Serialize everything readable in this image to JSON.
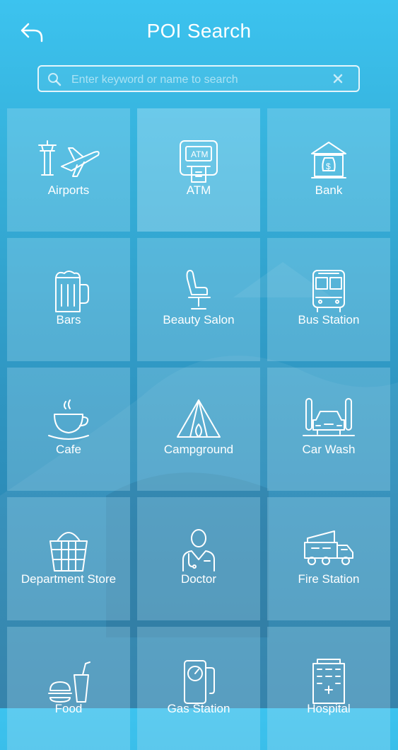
{
  "header": {
    "title": "POI Search"
  },
  "search": {
    "placeholder": "Enter keyword or name to search",
    "value": ""
  },
  "categories": [
    {
      "label": "Airports",
      "icon": "airport-icon"
    },
    {
      "label": "ATM",
      "icon": "atm-icon"
    },
    {
      "label": "Bank",
      "icon": "bank-icon"
    },
    {
      "label": "Bars",
      "icon": "beer-mug-icon"
    },
    {
      "label": "Beauty Salon",
      "icon": "salon-chair-icon"
    },
    {
      "label": "Bus Station",
      "icon": "bus-icon"
    },
    {
      "label": "Cafe",
      "icon": "coffee-cup-icon"
    },
    {
      "label": "Campground",
      "icon": "tent-icon"
    },
    {
      "label": "Car Wash",
      "icon": "car-wash-icon"
    },
    {
      "label": "Department Store",
      "icon": "shopping-basket-icon"
    },
    {
      "label": "Doctor",
      "icon": "doctor-icon"
    },
    {
      "label": "Fire Station",
      "icon": "fire-truck-icon"
    },
    {
      "label": "Food",
      "icon": "burger-drink-icon"
    },
    {
      "label": "Gas Station",
      "icon": "gas-pump-icon"
    },
    {
      "label": "Hospital",
      "icon": "hospital-building-icon"
    }
  ]
}
